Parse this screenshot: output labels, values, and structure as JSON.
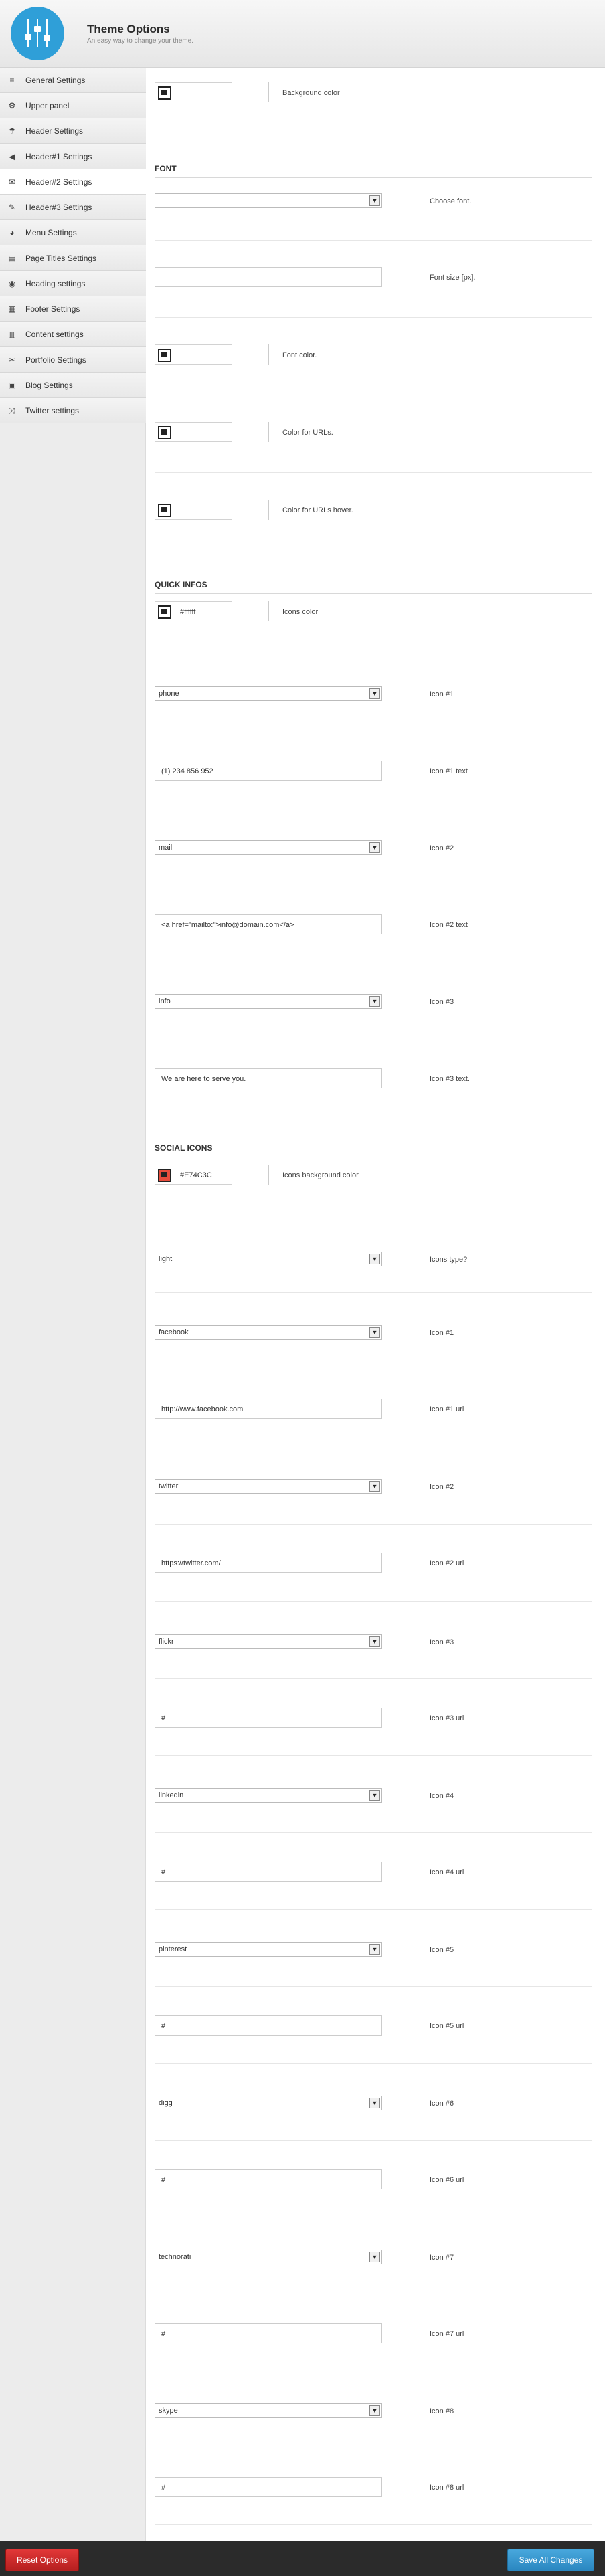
{
  "header": {
    "title": "Theme Options",
    "subtitle": "An easy way to change your theme."
  },
  "sidebar": {
    "items": [
      {
        "label": "General Settings",
        "icon": "sliders-icon"
      },
      {
        "label": "Upper panel",
        "icon": "gear-icon"
      },
      {
        "label": "Header Settings",
        "icon": "umbrella-icon"
      },
      {
        "label": "Header#1 Settings",
        "icon": "megaphone-icon"
      },
      {
        "label": "Header#2 Settings",
        "icon": "envelope-icon"
      },
      {
        "label": "Header#3 Settings",
        "icon": "pen-icon"
      },
      {
        "label": "Menu Settings",
        "icon": "pie-chart-icon"
      },
      {
        "label": "Page Titles Settings",
        "icon": "document-icon"
      },
      {
        "label": "Heading settings",
        "icon": "eye-icon"
      },
      {
        "label": "Footer Settings",
        "icon": "footer-icon"
      },
      {
        "label": "Content settings",
        "icon": "content-icon"
      },
      {
        "label": "Portfolio Settings",
        "icon": "scissors-icon"
      },
      {
        "label": "Blog Settings",
        "icon": "book-icon"
      },
      {
        "label": "Twitter settings",
        "icon": "shuffle-icon"
      }
    ],
    "active_index": 4
  },
  "main": {
    "bg_color": {
      "value": "",
      "label": "Background color"
    },
    "font": {
      "title": "FONT",
      "choose_font": {
        "value": "",
        "label": "Choose font."
      },
      "font_size": {
        "value": "",
        "label": "Font size [px]."
      },
      "font_color": {
        "value": "",
        "label": "Font color."
      },
      "url_color": {
        "value": "",
        "label": "Color for URLs."
      },
      "url_hover": {
        "value": "",
        "label": "Color for URLs hover."
      }
    },
    "quick": {
      "title": "QUICK INFOS",
      "icons_color": {
        "value": "#ffffff",
        "label": "Icons color"
      },
      "icon1": {
        "value": "phone",
        "label": "Icon #1"
      },
      "icon1_text": {
        "value": "(1) 234 856 952",
        "label": "Icon #1 text"
      },
      "icon2": {
        "value": "mail",
        "label": "Icon #2"
      },
      "icon2_text": {
        "value": "<a href=\"mailto:\">info@domain.com</a>",
        "label": "Icon #2 text"
      },
      "icon3": {
        "value": "info",
        "label": "Icon #3"
      },
      "icon3_text": {
        "value": "We are here to serve you.",
        "label": "Icon #3 text."
      }
    },
    "social": {
      "title": "SOCIAL ICONS",
      "bg_color": {
        "value": "#E74C3C",
        "label": "Icons background color"
      },
      "type": {
        "value": "light",
        "label": "Icons type?"
      },
      "icon1": {
        "value": "facebook",
        "label": "Icon #1"
      },
      "icon1_url": {
        "value": "http://www.facebook.com",
        "label": "Icon #1 url"
      },
      "icon2": {
        "value": "twitter",
        "label": "Icon #2"
      },
      "icon2_url": {
        "value": "https://twitter.com/",
        "label": "Icon #2 url"
      },
      "icon3": {
        "value": "flickr",
        "label": "Icon #3"
      },
      "icon3_url": {
        "value": "#",
        "label": "Icon #3 url"
      },
      "icon4": {
        "value": "linkedin",
        "label": "Icon #4"
      },
      "icon4_url": {
        "value": "#",
        "label": "Icon #4 url"
      },
      "icon5": {
        "value": "pinterest",
        "label": "Icon #5"
      },
      "icon5_url": {
        "value": "#",
        "label": "Icon #5 url"
      },
      "icon6": {
        "value": "digg",
        "label": "Icon #6"
      },
      "icon6_url": {
        "value": "#",
        "label": "Icon #6 url"
      },
      "icon7": {
        "value": "technorati",
        "label": "Icon #7"
      },
      "icon7_url": {
        "value": "#",
        "label": "Icon #7 url"
      },
      "icon8": {
        "value": "skype",
        "label": "Icon #8"
      },
      "icon8_url": {
        "value": "#",
        "label": "Icon #8 url"
      }
    }
  },
  "footer": {
    "reset_label": "Reset Options",
    "save_label": "Save All Changes"
  },
  "colors": {
    "accent": "#2f9fd8",
    "reset": "#c62828",
    "save": "#3498db",
    "social_bg": "#E74C3C"
  }
}
